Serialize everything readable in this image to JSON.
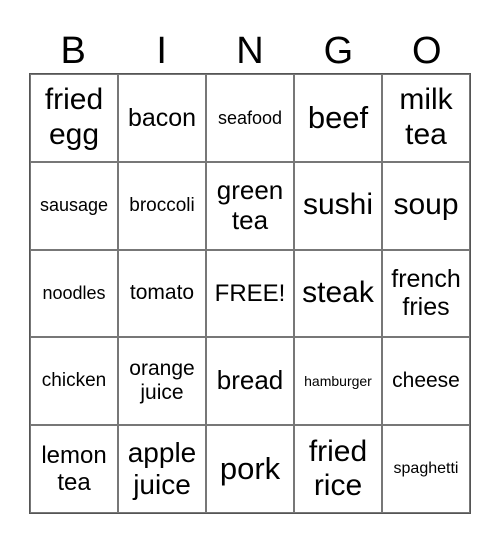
{
  "header": [
    "B",
    "I",
    "N",
    "G",
    "O"
  ],
  "cells": [
    "fried\negg",
    "bacon",
    "seafood",
    "beef",
    "milk\ntea",
    "sausage",
    "broccoli",
    "green\ntea",
    "sushi",
    "soup",
    "noodles",
    "tomato",
    "FREE!",
    "steak",
    "french\nfries",
    "chicken",
    "orange\njuice",
    "bread",
    "hamburger",
    "cheese",
    "lemon\ntea",
    "apple\njuice",
    "pork",
    "fried\nrice",
    "spaghetti"
  ]
}
